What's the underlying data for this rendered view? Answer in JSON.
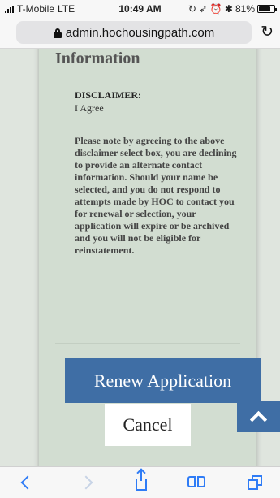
{
  "status_bar": {
    "carrier": "T-Mobile",
    "network": "LTE",
    "time": "10:49 AM",
    "indicators": "↻ ➶ ⏰ ✱",
    "battery_percent": "81%",
    "battery_level": 0.81
  },
  "browser": {
    "url": "admin.hochousingpath.com",
    "reload_glyph": "↻"
  },
  "page": {
    "section_heading": "Information",
    "disclaimer_label": "DISCLAIMER:",
    "disclaimer_value": "I Agree",
    "notice": "Please note by agreeing to the above disclaimer select box, you are declining to provide an alternate contact information. Should your name be selected, and you do not respond to attempts made by HOC to contact you for renewal or selection, your application will expire or be archived and you will not be eligible for reinstatement.",
    "renew_label": "Renew Application",
    "cancel_label": "Cancel"
  },
  "colors": {
    "accent": "#3f6ea5",
    "panel": "#d2ddd1",
    "page_background": "#dfe5de",
    "ios_blue": "#2f7cf6"
  },
  "icons": {
    "lock": "lock-icon",
    "reload": "reload-icon",
    "scroll_top": "chevron-up-icon",
    "back": "chevron-left-icon",
    "forward": "chevron-right-icon",
    "share": "share-icon",
    "bookmarks": "book-icon",
    "tabs": "tabs-icon"
  }
}
